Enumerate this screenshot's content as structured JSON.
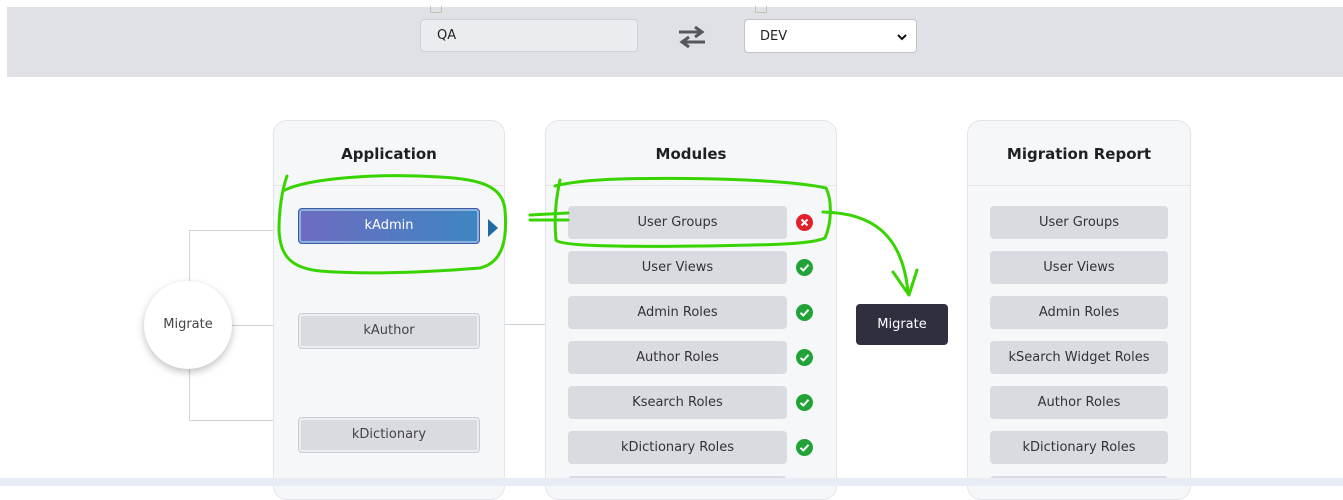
{
  "source": {
    "value": "QA"
  },
  "target": {
    "selected": "DEV"
  },
  "application": {
    "title": "Application",
    "items": [
      {
        "label": "kAdmin",
        "active": true
      },
      {
        "label": "kAuthor",
        "active": false
      },
      {
        "label": "kDictionary",
        "active": false
      }
    ]
  },
  "modules": {
    "title": "Modules",
    "items": [
      {
        "label": "User Groups",
        "status": "error"
      },
      {
        "label": "User Views",
        "status": "success"
      },
      {
        "label": "Admin Roles",
        "status": "success"
      },
      {
        "label": "Author Roles",
        "status": "success"
      },
      {
        "label": "Ksearch Roles",
        "status": "success"
      },
      {
        "label": "kDictionary Roles",
        "status": "success"
      }
    ]
  },
  "report": {
    "title": "Migration Report",
    "items": [
      {
        "label": "User Groups"
      },
      {
        "label": "User Views"
      },
      {
        "label": "Admin Roles"
      },
      {
        "label": "kSearch Widget Roles"
      },
      {
        "label": "Author Roles"
      },
      {
        "label": "kDictionary Roles"
      }
    ]
  },
  "migrate_circle": {
    "label": "Migrate"
  },
  "migrate_button": {
    "label": "Migrate"
  },
  "colors": {
    "active_start": "#6e6cc0",
    "active_end": "#3d86c2",
    "ok": "#22a338",
    "error": "#e3212d",
    "annotation": "#39d400"
  },
  "icons": [
    "swap-arrows-icon",
    "chevron-down-icon",
    "check-circle-icon",
    "error-circle-icon",
    "caret-right-icon"
  ]
}
